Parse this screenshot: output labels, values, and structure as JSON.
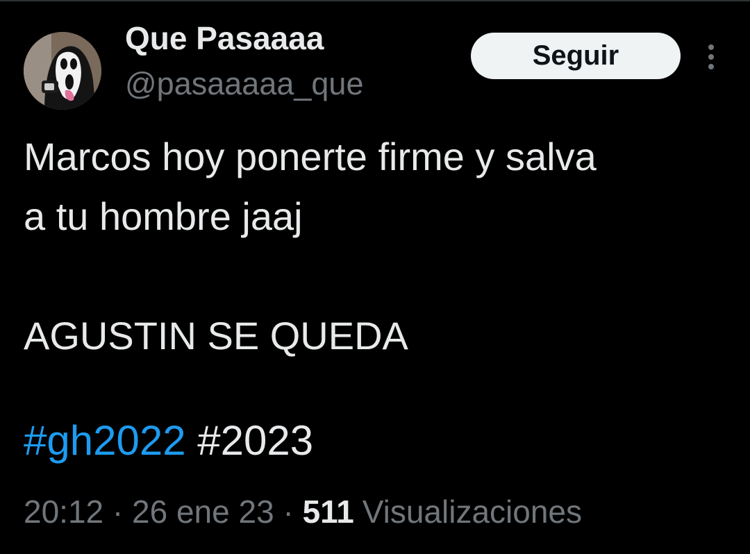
{
  "author": {
    "display_name": "Que Pasaaaa",
    "handle": "@pasaaaaa_que",
    "avatar_icon": "scream-mask-avatar"
  },
  "actions": {
    "follow_label": "Seguir",
    "more_icon": "more-vertical-icon"
  },
  "tweet": {
    "lines": [
      "Marcos hoy ponerte firme y salva",
      "a tu hombre jaaj",
      "",
      "AGUSTIN SE QUEDA"
    ],
    "hashtags": {
      "first": "#gh2022",
      "second": "#2023"
    }
  },
  "meta": {
    "time": "20:12",
    "separator": "·",
    "date": "26 ene 23",
    "views_count": "511",
    "views_label": "Visualizaciones"
  },
  "colors": {
    "background": "#000000",
    "text": "#e7e9ea",
    "secondary": "#71767b",
    "link": "#1d9bf0",
    "button_bg": "#eff3f4"
  }
}
